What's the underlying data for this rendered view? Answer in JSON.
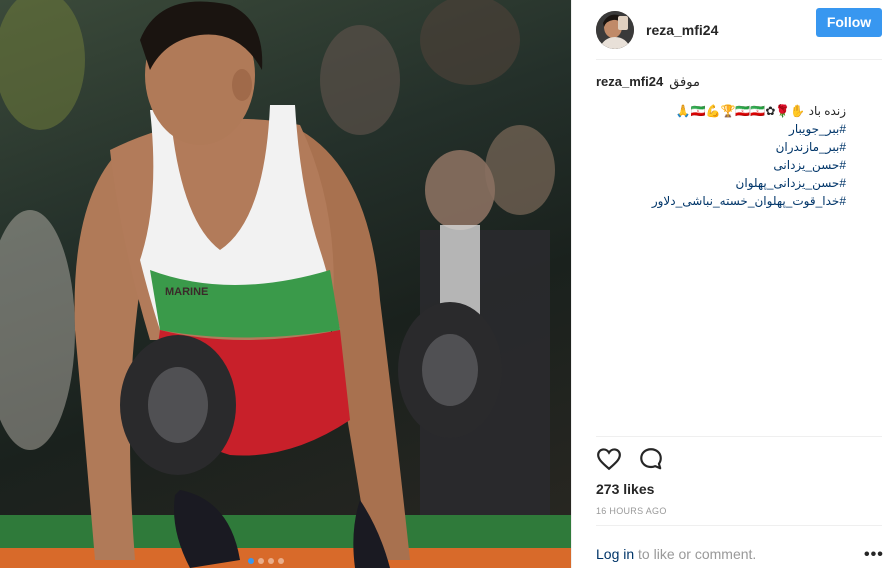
{
  "post": {
    "username": "reza_mfi24",
    "follow_label": "Follow",
    "caption": {
      "username": "reza_mfi24",
      "word": "موفق",
      "text": "زنده باد ✋🌹✿🇮🇷💪🏆🇮🇷🇮🇷🙏",
      "hashtags": [
        "#ببر_جویبار",
        "#ببر_مازندران",
        "#حسن_یزدانی",
        "#حسن_یزدانی_پهلوان",
        "#خدا_قوت_پهلوان_خسته_نباشی_دلاور"
      ]
    },
    "likes": "273 likes",
    "time": "16 HOURS AGO",
    "footer": {
      "login_link": "Log in",
      "suffix": " to like or comment.",
      "more": "•••"
    }
  },
  "icons": {
    "like": "heart-icon",
    "comment": "comment-icon",
    "more": "more-options-icon"
  },
  "colors": {
    "accent": "#3897f0",
    "link": "#003569",
    "muted": "#999999",
    "text": "#262626",
    "singlet_red": "#c8202a",
    "singlet_green": "#3a9a4a"
  }
}
